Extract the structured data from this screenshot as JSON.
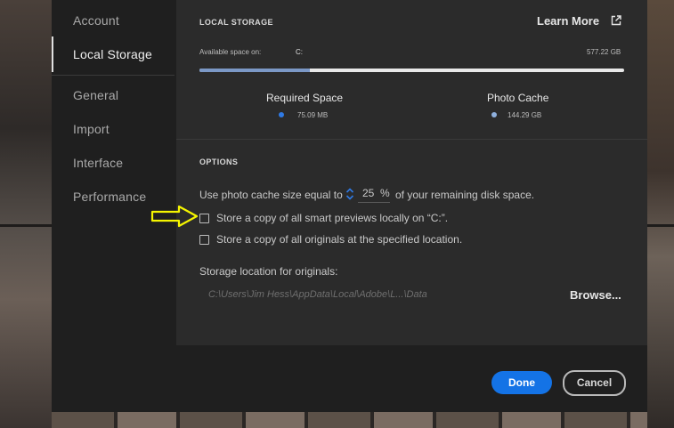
{
  "sidebar": {
    "items": [
      {
        "label": "Account"
      },
      {
        "label": "Local Storage"
      },
      {
        "label": "General"
      },
      {
        "label": "Import"
      },
      {
        "label": "Interface"
      },
      {
        "label": "Performance"
      }
    ],
    "active": "Local Storage"
  },
  "local_storage": {
    "title": "LOCAL STORAGE",
    "learn_more": "Learn More",
    "learn_more_icon": "external-link-icon",
    "available_label": "Available space on:",
    "drive": "C:",
    "total_space": "577.22 GB",
    "usage_fraction": 0.26,
    "required": {
      "label": "Required Space",
      "value": "75.09 MB",
      "color": "#2f7ae5"
    },
    "cache": {
      "label": "Photo Cache",
      "value": "144.29 GB",
      "color": "#8fb0dd"
    }
  },
  "options": {
    "title": "OPTIONS",
    "cache_prefix": "Use photo cache size equal to",
    "cache_percent": "25",
    "percent_sign": "%",
    "cache_suffix": "of your remaining disk space.",
    "checkbox_previews": "Store a copy of all smart previews locally on “C:”.",
    "checkbox_originals": "Store a copy of all originals at the specified location.",
    "storage_location_label": "Storage location for originals:",
    "storage_path": "C:\\Users\\Jim Hess\\AppData\\Local\\Adobe\\L...\\Data",
    "browse": "Browse..."
  },
  "buttons": {
    "done": "Done",
    "cancel": "Cancel"
  },
  "annotation": {
    "arrow_color": "#f5f500",
    "arrow_icon": "arrow-right-icon"
  }
}
